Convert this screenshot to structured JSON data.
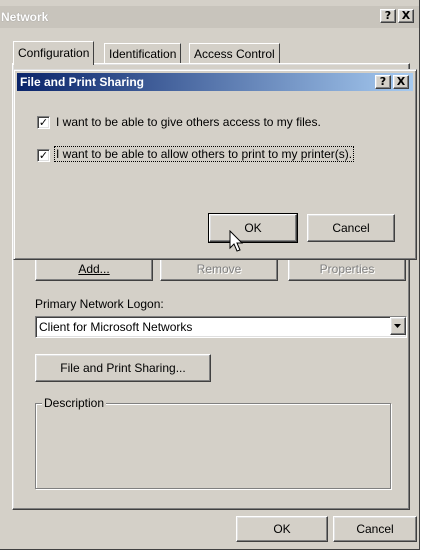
{
  "window": {
    "title": "Network",
    "help_btn": "?",
    "close_btn": "X",
    "tabs": [
      "Configuration",
      "Identification",
      "Access Control"
    ],
    "buttons": {
      "add": "Add...",
      "remove": "Remove",
      "properties": "Properties"
    },
    "primary_logon_label": "Primary Network Logon:",
    "primary_logon_value": "Client for Microsoft Networks",
    "file_print_button": "File and Print Sharing...",
    "description_label": "Description",
    "ok": "OK",
    "cancel": "Cancel"
  },
  "dialog": {
    "title": "File and Print Sharing",
    "help_btn": "?",
    "close_btn": "X",
    "check1": {
      "label": "I want to be able to give others access to my files.",
      "checked": true
    },
    "check2": {
      "label": "I want to be able to allow others to print to my printer(s).",
      "checked": true
    },
    "ok": "OK",
    "cancel": "Cancel"
  },
  "colors": {
    "face": "#d4d0c8",
    "active_title_start": "#0a246a",
    "active_title_end": "#a6caf0"
  }
}
